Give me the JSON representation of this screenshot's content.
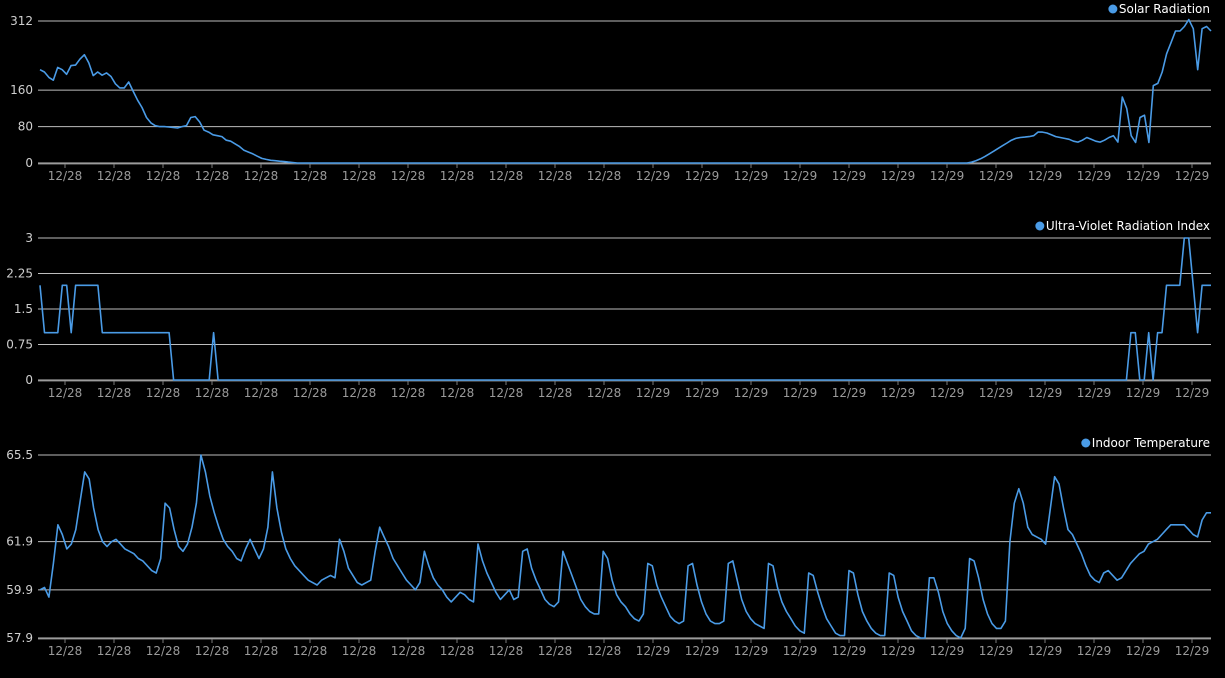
{
  "chart_data": [
    {
      "type": "line",
      "series": [
        {
          "name": "Solar Radiation",
          "color": "#4a9be6",
          "values": [
            205,
            200,
            188,
            182,
            210,
            205,
            195,
            214,
            215,
            228,
            238,
            220,
            192,
            200,
            193,
            198,
            190,
            174,
            165,
            165,
            178,
            158,
            138,
            122,
            100,
            88,
            82,
            80,
            80,
            79,
            78,
            77,
            80,
            82,
            100,
            102,
            90,
            72,
            68,
            62,
            60,
            58,
            50,
            48,
            42,
            36,
            28,
            24,
            20,
            15,
            10,
            8,
            6,
            5,
            4,
            3,
            2,
            1,
            0,
            0,
            0,
            0,
            0,
            0,
            0,
            0,
            0,
            0,
            0,
            0,
            0,
            0,
            0,
            0,
            0,
            0,
            0,
            0,
            0,
            0,
            0,
            0,
            0,
            0,
            0,
            0,
            0,
            0,
            0,
            0,
            0,
            0,
            0,
            0,
            0,
            0,
            0,
            0,
            0,
            0,
            0,
            0,
            0,
            0,
            0,
            0,
            0,
            0,
            0,
            0,
            0,
            0,
            0,
            0,
            0,
            0,
            0,
            0,
            0,
            0,
            0,
            0,
            0,
            0,
            0,
            0,
            0,
            0,
            0,
            0,
            0,
            0,
            0,
            0,
            0,
            0,
            0,
            0,
            0,
            0,
            0,
            0,
            0,
            0,
            0,
            0,
            0,
            0,
            0,
            0,
            0,
            0,
            0,
            0,
            0,
            0,
            0,
            0,
            0,
            0,
            0,
            0,
            0,
            0,
            0,
            0,
            0,
            0,
            0,
            0,
            0,
            0,
            0,
            0,
            0,
            0,
            0,
            0,
            0,
            0,
            0,
            0,
            0,
            0,
            0,
            0,
            0,
            0,
            0,
            0,
            0,
            0,
            0,
            0,
            0,
            0,
            0,
            0,
            0,
            0,
            0,
            0,
            0,
            0,
            0,
            0,
            0,
            0,
            0,
            0,
            2,
            5,
            9,
            14,
            20,
            26,
            32,
            38,
            44,
            50,
            54,
            56,
            57,
            58,
            60,
            68,
            68,
            66,
            62,
            58,
            56,
            54,
            52,
            48,
            46,
            50,
            56,
            52,
            48,
            46,
            50,
            56,
            60,
            46,
            145,
            120,
            60,
            45,
            100,
            105,
            45,
            170,
            175,
            200,
            240,
            265,
            290,
            290,
            300,
            315,
            295,
            205,
            295,
            300,
            290
          ]
        }
      ],
      "x_tick_labels": [
        "12/28",
        "12/28",
        "12/28",
        "12/28",
        "12/28",
        "12/28",
        "12/28",
        "12/28",
        "12/28",
        "12/28",
        "12/28",
        "12/28",
        "12/29",
        "12/29",
        "12/29",
        "12/29",
        "12/29",
        "12/29",
        "12/29",
        "12/29",
        "12/29",
        "12/29",
        "12/29",
        "12/29"
      ],
      "y_ticks": [
        "0",
        "80",
        "160",
        "312"
      ],
      "ylim": [
        0,
        312
      ],
      "legend": "top-right",
      "grid": true
    },
    {
      "type": "line",
      "series": [
        {
          "name": "Ultra-Violet Radiation Index",
          "color": "#4a9be6",
          "values": [
            2,
            1,
            1,
            1,
            1,
            2,
            2,
            1,
            2,
            2,
            2,
            2,
            2,
            2,
            1,
            1,
            1,
            1,
            1,
            1,
            1,
            1,
            1,
            1,
            1,
            1,
            1,
            1,
            1,
            1,
            0,
            0,
            0,
            0,
            0,
            0,
            0,
            0,
            0,
            1,
            0,
            0,
            0,
            0,
            0,
            0,
            0,
            0,
            0,
            0,
            0,
            0,
            0,
            0,
            0,
            0,
            0,
            0,
            0,
            0,
            0,
            0,
            0,
            0,
            0,
            0,
            0,
            0,
            0,
            0,
            0,
            0,
            0,
            0,
            0,
            0,
            0,
            0,
            0,
            0,
            0,
            0,
            0,
            0,
            0,
            0,
            0,
            0,
            0,
            0,
            0,
            0,
            0,
            0,
            0,
            0,
            0,
            0,
            0,
            0,
            0,
            0,
            0,
            0,
            0,
            0,
            0,
            0,
            0,
            0,
            0,
            0,
            0,
            0,
            0,
            0,
            0,
            0,
            0,
            0,
            0,
            0,
            0,
            0,
            0,
            0,
            0,
            0,
            0,
            0,
            0,
            0,
            0,
            0,
            0,
            0,
            0,
            0,
            0,
            0,
            0,
            0,
            0,
            0,
            0,
            0,
            0,
            0,
            0,
            0,
            0,
            0,
            0,
            0,
            0,
            0,
            0,
            0,
            0,
            0,
            0,
            0,
            0,
            0,
            0,
            0,
            0,
            0,
            0,
            0,
            0,
            0,
            0,
            0,
            0,
            0,
            0,
            0,
            0,
            0,
            0,
            0,
            0,
            0,
            0,
            0,
            0,
            0,
            0,
            0,
            0,
            0,
            0,
            0,
            0,
            0,
            0,
            0,
            0,
            0,
            0,
            0,
            0,
            0,
            0,
            0,
            0,
            0,
            0,
            0,
            0,
            0,
            0,
            0,
            0,
            0,
            0,
            0,
            0,
            0,
            0,
            0,
            0,
            0,
            0,
            0,
            0,
            0,
            0,
            0,
            0,
            0,
            0,
            0,
            0,
            0,
            0,
            0,
            0,
            0,
            0,
            0,
            0,
            0,
            0,
            1,
            1,
            0,
            0,
            1,
            0,
            1,
            1,
            2,
            2,
            2,
            2,
            3,
            3,
            2,
            1,
            2,
            2,
            2
          ]
        }
      ],
      "x_tick_labels": [
        "12/28",
        "12/28",
        "12/28",
        "12/28",
        "12/28",
        "12/28",
        "12/28",
        "12/28",
        "12/28",
        "12/28",
        "12/28",
        "12/28",
        "12/29",
        "12/29",
        "12/29",
        "12/29",
        "12/29",
        "12/29",
        "12/29",
        "12/29",
        "12/29",
        "12/29",
        "12/29",
        "12/29"
      ],
      "y_ticks": [
        "0",
        "0.75",
        "1.5",
        "2.25",
        "3"
      ],
      "ylim": [
        0,
        3
      ],
      "legend": "top-right",
      "grid": true
    },
    {
      "type": "line",
      "series": [
        {
          "name": "Indoor Temperature",
          "color": "#4a9be6",
          "values": [
            59.9,
            60,
            59.6,
            61,
            62.6,
            62.2,
            61.6,
            61.8,
            62.4,
            63.6,
            64.8,
            64.5,
            63.3,
            62.4,
            61.9,
            61.7,
            61.9,
            62,
            61.8,
            61.6,
            61.5,
            61.4,
            61.2,
            61.1,
            60.9,
            60.7,
            60.6,
            61.2,
            63.5,
            63.3,
            62.4,
            61.7,
            61.5,
            61.8,
            62.5,
            63.5,
            65.5,
            64.8,
            63.8,
            63.1,
            62.5,
            62,
            61.7,
            61.5,
            61.2,
            61.1,
            61.6,
            62,
            61.6,
            61.2,
            61.6,
            62.5,
            64.8,
            63.3,
            62.3,
            61.6,
            61.2,
            60.9,
            60.7,
            60.5,
            60.3,
            60.2,
            60.1,
            60.3,
            60.4,
            60.5,
            60.4,
            62,
            61.5,
            60.8,
            60.5,
            60.2,
            60.1,
            60.2,
            60.3,
            61.5,
            62.5,
            62.1,
            61.7,
            61.2,
            60.9,
            60.6,
            60.3,
            60.1,
            59.9,
            60.2,
            61.5,
            60.9,
            60.4,
            60.1,
            59.9,
            59.6,
            59.4,
            59.6,
            59.8,
            59.7,
            59.5,
            59.4,
            61.8,
            61.1,
            60.6,
            60.2,
            59.8,
            59.5,
            59.7,
            59.9,
            59.5,
            59.6,
            61.5,
            61.6,
            60.8,
            60.3,
            59.9,
            59.5,
            59.3,
            59.2,
            59.4,
            61.5,
            61,
            60.5,
            60,
            59.5,
            59.2,
            59,
            58.9,
            58.9,
            61.5,
            61.2,
            60.3,
            59.7,
            59.4,
            59.2,
            58.9,
            58.7,
            58.6,
            58.9,
            61,
            60.9,
            60.1,
            59.6,
            59.2,
            58.8,
            58.6,
            58.5,
            58.6,
            60.9,
            61,
            60.1,
            59.4,
            58.9,
            58.6,
            58.5,
            58.5,
            58.6,
            61,
            61.1,
            60.3,
            59.5,
            59,
            58.7,
            58.5,
            58.4,
            58.3,
            61,
            60.9,
            60,
            59.4,
            59,
            58.7,
            58.4,
            58.2,
            58.1,
            60.6,
            60.5,
            59.8,
            59.2,
            58.7,
            58.4,
            58.1,
            58,
            58,
            60.7,
            60.6,
            59.7,
            59,
            58.6,
            58.3,
            58.1,
            58,
            58,
            60.6,
            60.5,
            59.6,
            59,
            58.6,
            58.2,
            58,
            57.9,
            57.9,
            60.4,
            60.4,
            59.8,
            59,
            58.5,
            58.2,
            58,
            57.9,
            58.3,
            61.2,
            61.1,
            60.4,
            59.5,
            58.9,
            58.5,
            58.3,
            58.3,
            58.6,
            61.9,
            63.5,
            64.1,
            63.5,
            62.5,
            62.2,
            62.1,
            62,
            61.8,
            63.2,
            64.6,
            64.3,
            63.3,
            62.4,
            62.2,
            61.8,
            61.4,
            60.9,
            60.5,
            60.3,
            60.2,
            60.6,
            60.7,
            60.5,
            60.3,
            60.4,
            60.7,
            61,
            61.2,
            61.4,
            61.5,
            61.8,
            61.9,
            62,
            62.2,
            62.4,
            62.6,
            62.6,
            62.6,
            62.6,
            62.4,
            62.2,
            62.1,
            62.8,
            63.1,
            63.1
          ]
        }
      ],
      "x_tick_labels": [
        "12/28",
        "12/28",
        "12/28",
        "12/28",
        "12/28",
        "12/28",
        "12/28",
        "12/28",
        "12/28",
        "12/28",
        "12/28",
        "12/28",
        "12/29",
        "12/29",
        "12/29",
        "12/29",
        "12/29",
        "12/29",
        "12/29",
        "12/29",
        "12/29",
        "12/29",
        "12/29",
        "12/29"
      ],
      "y_ticks": [
        "57.9",
        "59.9",
        "61.9",
        "65.5"
      ],
      "ylim": [
        57.9,
        65.5
      ],
      "legend": "top-right",
      "grid": true
    }
  ]
}
